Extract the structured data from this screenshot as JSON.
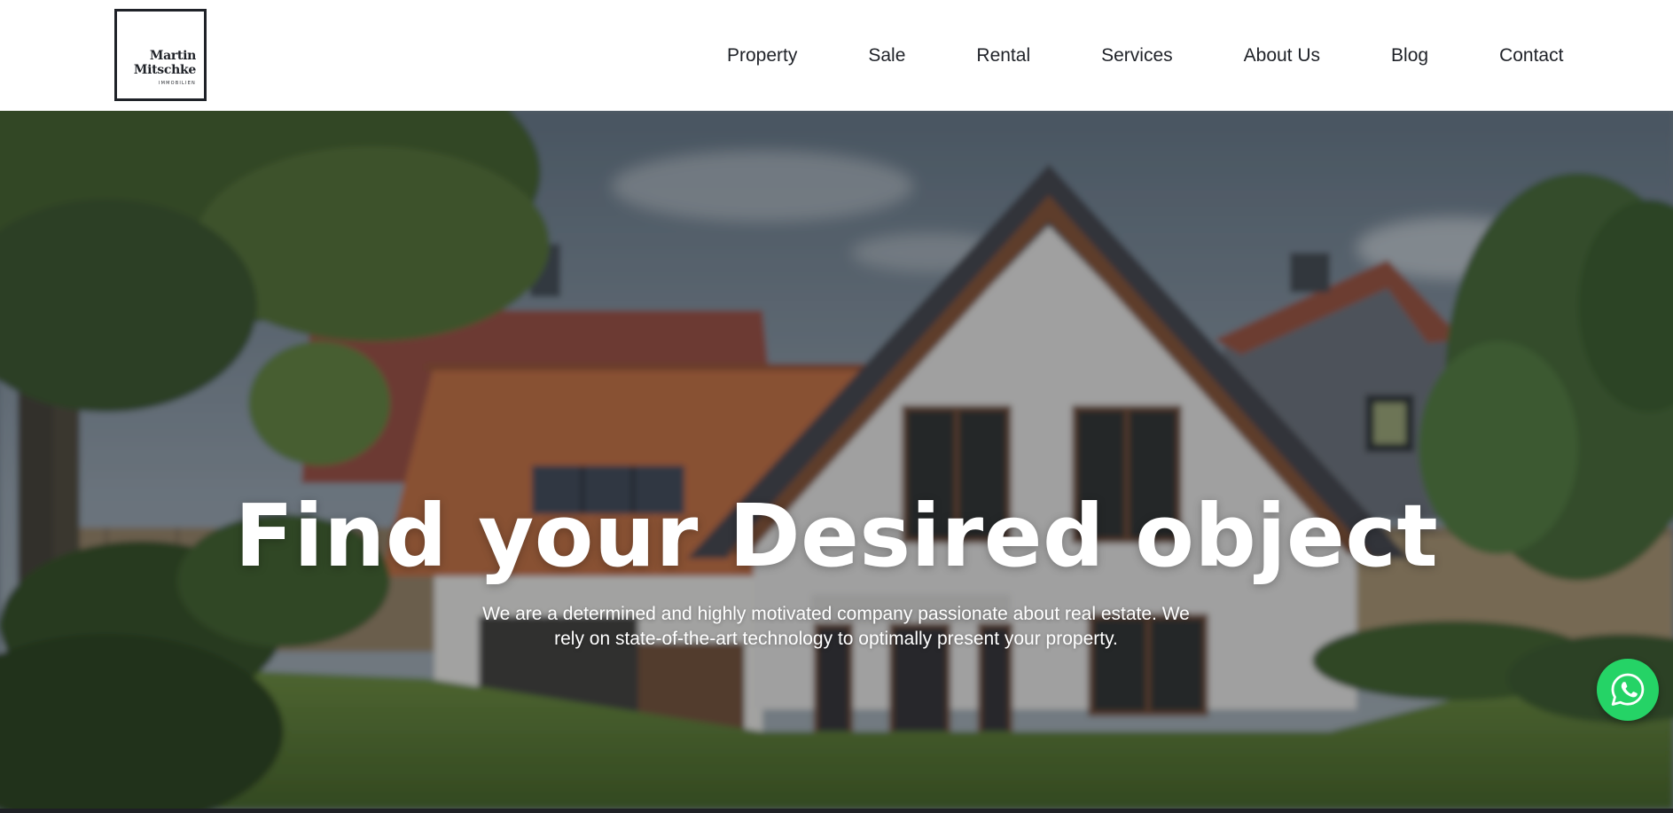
{
  "brand": {
    "logo_line1": "Martin",
    "logo_line2": "Mitschke",
    "logo_sub": "IMMOBILIEN"
  },
  "nav": {
    "items": [
      {
        "label": "Property"
      },
      {
        "label": "Sale"
      },
      {
        "label": "Rental"
      },
      {
        "label": "Services"
      },
      {
        "label": "About Us"
      },
      {
        "label": "Blog"
      },
      {
        "label": "Contact"
      }
    ]
  },
  "hero": {
    "title": "Find your Desired object",
    "text": "We are a determined and highly motivated company passionate about real estate. We rely on state-of-the-art technology to optimally present your property."
  },
  "whatsapp": {
    "icon": "whatsapp-icon",
    "color": "#25d366"
  },
  "colors": {
    "text_dark": "#1f2228",
    "header_bg": "#ffffff",
    "hero_text": "#ffffff"
  }
}
